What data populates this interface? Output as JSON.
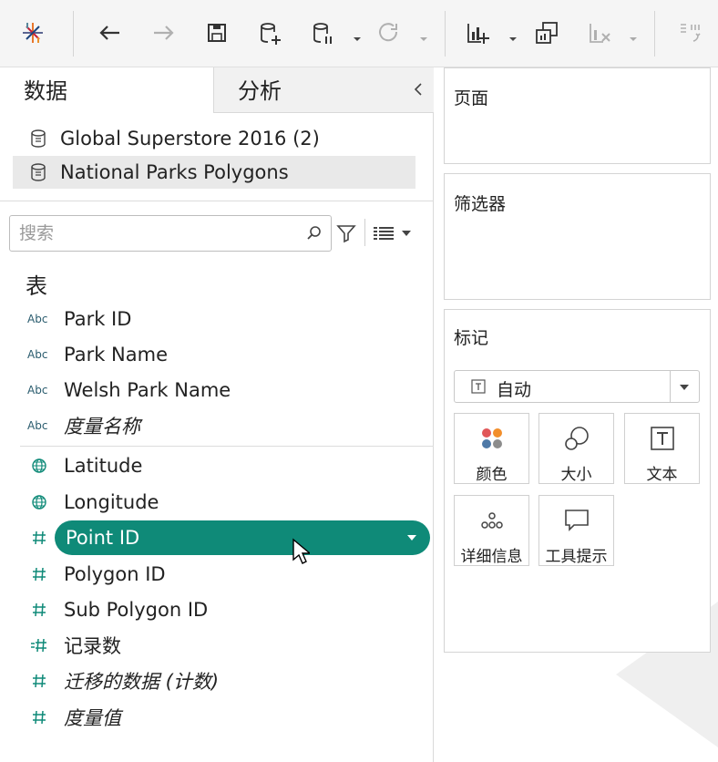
{
  "left_panel": {
    "tabs": {
      "data": "数据",
      "analytics": "分析"
    },
    "datasources": [
      {
        "name": "Global Superstore 2016 (2)"
      },
      {
        "name": "National Parks Polygons"
      }
    ],
    "search": {
      "placeholder": "搜索"
    },
    "tables_heading": "表",
    "fields": [
      {
        "type": "Abc",
        "name": "Park ID"
      },
      {
        "type": "Abc",
        "name": "Park Name"
      },
      {
        "type": "Abc",
        "name": "Welsh Park Name"
      },
      {
        "type": "Abc",
        "name": "度量名称"
      },
      {
        "type": "globe-icon",
        "name": "Latitude"
      },
      {
        "type": "globe-icon",
        "name": "Longitude"
      },
      {
        "type": "hash-icon",
        "name": "Point ID"
      },
      {
        "type": "hash-icon",
        "name": "Polygon ID"
      },
      {
        "type": "hash-icon",
        "name": "Sub Polygon ID"
      },
      {
        "type": "calc-hash-icon",
        "name": "记录数"
      },
      {
        "type": "hash-icon",
        "name": "迁移的数据 (计数)"
      },
      {
        "type": "hash-icon",
        "name": "度量值"
      }
    ],
    "selected_field": "Point ID"
  },
  "right_panel": {
    "pages_title": "页面",
    "filters_title": "筛选器",
    "marks_title": "标记",
    "mark_type": "自动",
    "mark_buttons": [
      {
        "label": "颜色",
        "icon": "color-icon"
      },
      {
        "label": "大小",
        "icon": "size-icon"
      },
      {
        "label": "文本",
        "icon": "text-icon"
      },
      {
        "label": "详细信息",
        "icon": "detail-icon"
      },
      {
        "label": "工具提示",
        "icon": "tooltip-icon"
      }
    ]
  },
  "colors": {
    "accent": "#0f8a78",
    "panel_bg": "#f5f5f5"
  }
}
